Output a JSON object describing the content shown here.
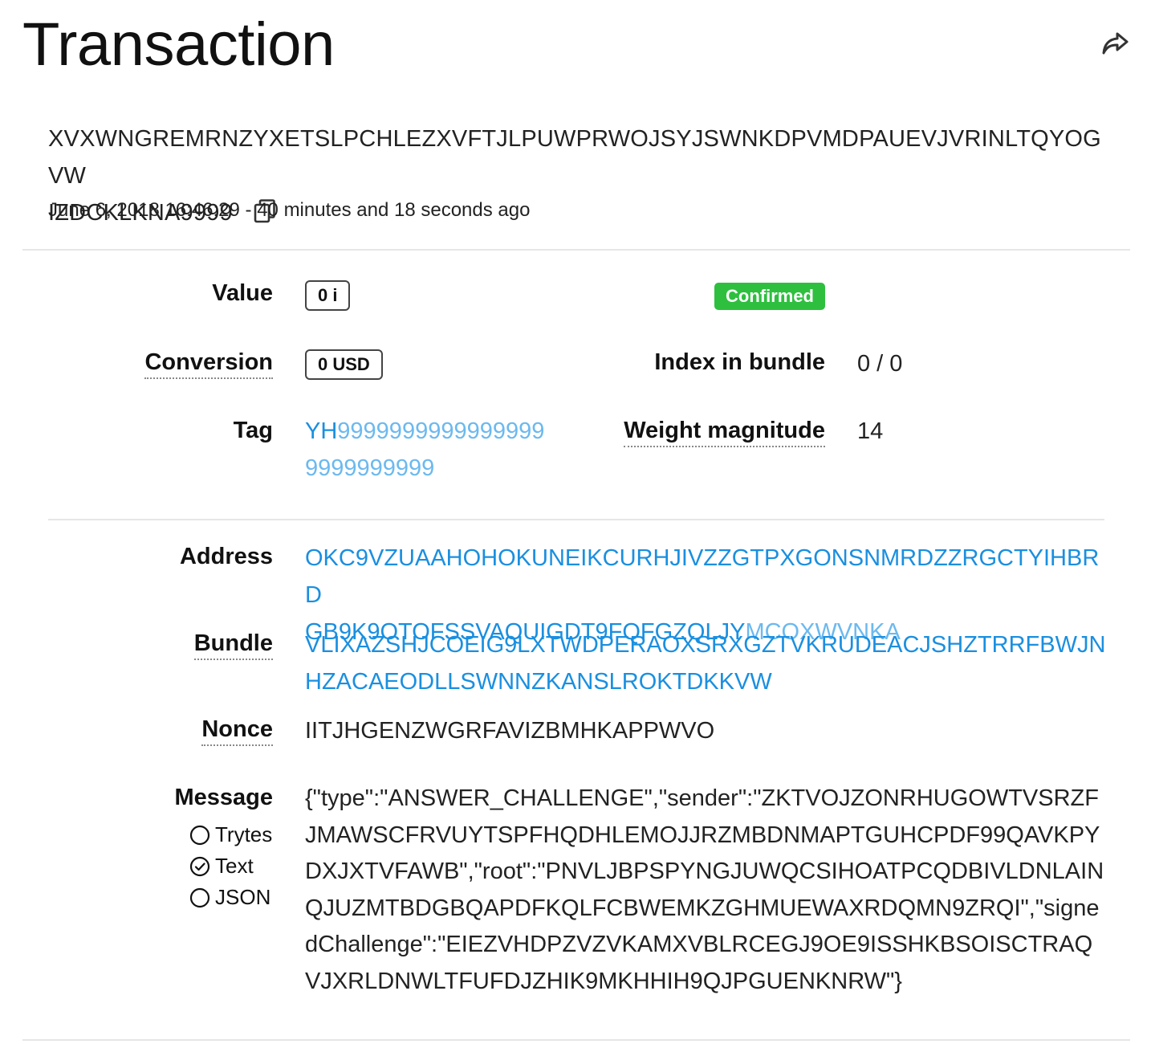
{
  "page": {
    "title": "Transaction"
  },
  "icons": {
    "share": "share-icon",
    "copy": "copy-icon",
    "radio_empty": "radio-empty-icon",
    "radio_checked": "radio-checked-icon"
  },
  "transaction": {
    "hash_line1": "XVXWNGREMRNZYXETSLPCHLEZXVFTJLPUWPRWOJSYJSWNKDPVMDPAUEVJVRINLTQYOGVW",
    "hash_line2": "IZDCKLKNA9999",
    "timestamp": "June 6, 2018 16:46:29 - 40 minutes and 18 seconds ago"
  },
  "details": {
    "value_label": "Value",
    "value": "0 i",
    "status": "Confirmed",
    "conversion_label": "Conversion",
    "conversion": "0 USD",
    "index_label": "Index in bundle",
    "index": "0 / 0",
    "tag_label": "Tag",
    "tag_line1_prefix": "YH",
    "tag_line1_rest": "9999999999999999",
    "tag_line2": "9999999999",
    "weight_label": "Weight magnitude",
    "weight": "14"
  },
  "address": {
    "label": "Address",
    "line1": "OKC9VZUAAHOHOKUNEIKCURHJIVZZGTPXGONSNMRDZZRGCTYIHBRD",
    "line2_main": "GB9K9OTOFSSVAQUIGDT9FQFGZQLJY",
    "line2_checksum": "MCOXWVNKA"
  },
  "bundle": {
    "label": "Bundle",
    "line1": "VLIXAZSHJCOEIG9LXTWDPERAOXSRXGZTVKRUDEACJSHZTRRFBWJN",
    "line2": "HZACAEODLLSWNNZKANSLROKTDKKVW"
  },
  "nonce": {
    "label": "Nonce",
    "value": "IITJHGENZWGRFAVIZBMHKAPPWVO"
  },
  "message": {
    "label": "Message",
    "formats": [
      {
        "label": "Trytes",
        "selected": false
      },
      {
        "label": "Text",
        "selected": true
      },
      {
        "label": "JSON",
        "selected": false
      }
    ],
    "content": "{\"type\":\"ANSWER_CHALLENGE\",\"sender\":\"ZKTVOJZONRHUGOWTVSRZFJMAWSCFRVUYTSPFHQDHLEMOJJRZMBDNMAPTGUHCPDF99QAVKPYDXJXTVFAWB\",\"root\":\"PNVLJBPSPYNGJUWQCSIHOATPCQDBIVLDNLAINQJUZMTBDGBQAPDFKQLFCBWEMKZGHMUEWAXRDQMN9ZRQI\",\"signedChallenge\":\"EIEZVHDPZVZVKAMXVBLRCEGJ9OE9ISSHKBSOISCTRAQVJXRLDNWLTFUFDJZHIK9MKHHIH9QJPGUENKNRW\"}"
  }
}
